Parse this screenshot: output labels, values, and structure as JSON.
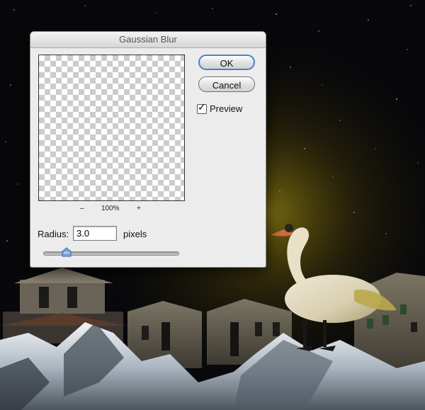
{
  "dialog": {
    "title": "Gaussian Blur",
    "ok_label": "OK",
    "cancel_label": "Cancel",
    "preview_label": "Preview",
    "preview_checked": true,
    "zoom_minus": "–",
    "zoom_level": "100%",
    "zoom_plus": "+",
    "radius_label": "Radius:",
    "radius_value": "3.0",
    "radius_unit": "pixels",
    "radius_slider_fraction": 0.17
  },
  "icons": {
    "check": "checkmark-icon",
    "slider": "slider-thumb-icon"
  },
  "colors": {
    "default_button_border": "#4f80c4",
    "slider_thumb": "#7aa6e0"
  }
}
